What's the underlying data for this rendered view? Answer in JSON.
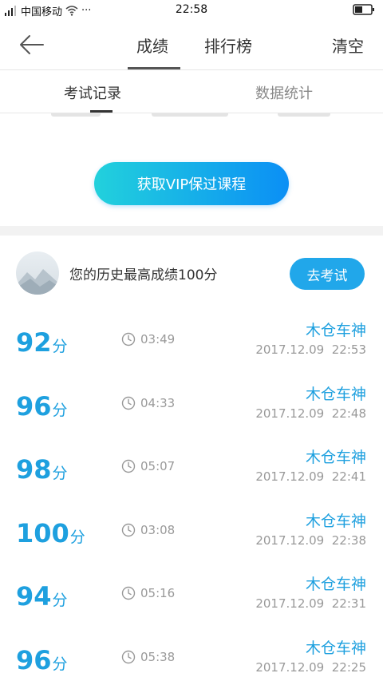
{
  "status_bar": {
    "carrier": "中国移动",
    "time": "22:58",
    "dots": "···"
  },
  "nav": {
    "tabs": [
      "成绩",
      "排行榜"
    ],
    "clear_label": "清空"
  },
  "sub_tabs": [
    "考试记录",
    "数据统计"
  ],
  "vip_button": "获取VIP保过课程",
  "history": {
    "text": "您的历史最高成绩100分",
    "exam_button": "去考试"
  },
  "records": [
    {
      "score": "92",
      "unit": "分",
      "duration": "03:49",
      "name": "木仓车神",
      "time": "2017.12.09  22:53"
    },
    {
      "score": "96",
      "unit": "分",
      "duration": "04:33",
      "name": "木仓车神",
      "time": "2017.12.09  22:48"
    },
    {
      "score": "98",
      "unit": "分",
      "duration": "05:07",
      "name": "木仓车神",
      "time": "2017.12.09  22:41"
    },
    {
      "score": "100",
      "unit": "分",
      "duration": "03:08",
      "name": "木仓车神",
      "time": "2017.12.09  22:38"
    },
    {
      "score": "94",
      "unit": "分",
      "duration": "05:16",
      "name": "木仓车神",
      "time": "2017.12.09  22:31"
    },
    {
      "score": "96",
      "unit": "分",
      "duration": "05:38",
      "name": "木仓车神",
      "time": "2017.12.09  22:25"
    }
  ],
  "colors": {
    "accent": "#1ea0df",
    "button": "#21a7ea",
    "gradient_start": "#22d1dc",
    "gradient_end": "#0b8ff5"
  },
  "icons": {
    "back": "arrow-left-icon",
    "clock": "clock-icon",
    "wifi": "wifi-icon",
    "battery": "battery-icon",
    "signal": "signal-icon"
  }
}
